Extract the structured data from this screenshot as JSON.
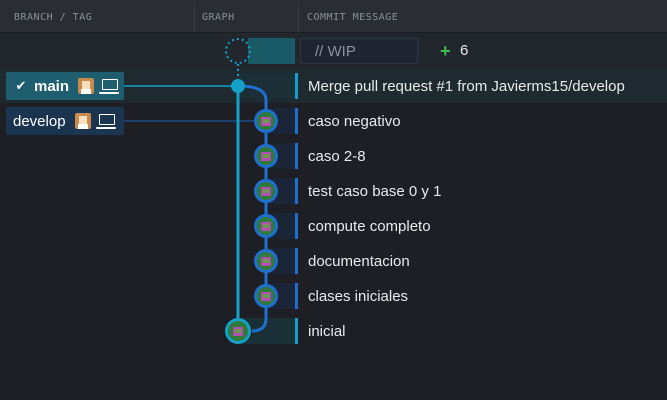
{
  "header": {
    "branch_tag": "BRANCH / TAG",
    "graph": "GRAPH",
    "commit_message": "COMMIT MESSAGE"
  },
  "wip": {
    "label": "// WIP",
    "plus": "+",
    "count": "6"
  },
  "branches": [
    {
      "name": "main",
      "checked": true
    },
    {
      "name": "develop",
      "checked": false
    }
  ],
  "commits": [
    {
      "message": "Merge pull request #1 from Javierms15/develop"
    },
    {
      "message": "caso negativo"
    },
    {
      "message": "caso 2-8"
    },
    {
      "message": "test caso base 0 y 1"
    },
    {
      "message": "compute completo"
    },
    {
      "message": "documentacion"
    },
    {
      "message": "clases iniciales"
    },
    {
      "message": "inicial"
    }
  ],
  "colors": {
    "main": "#14a0c8",
    "develop": "#1f6fd1",
    "accent_green": "#3fb950"
  },
  "icons": [
    "check-icon",
    "avatar-icon",
    "laptop-icon",
    "plus-icon"
  ]
}
